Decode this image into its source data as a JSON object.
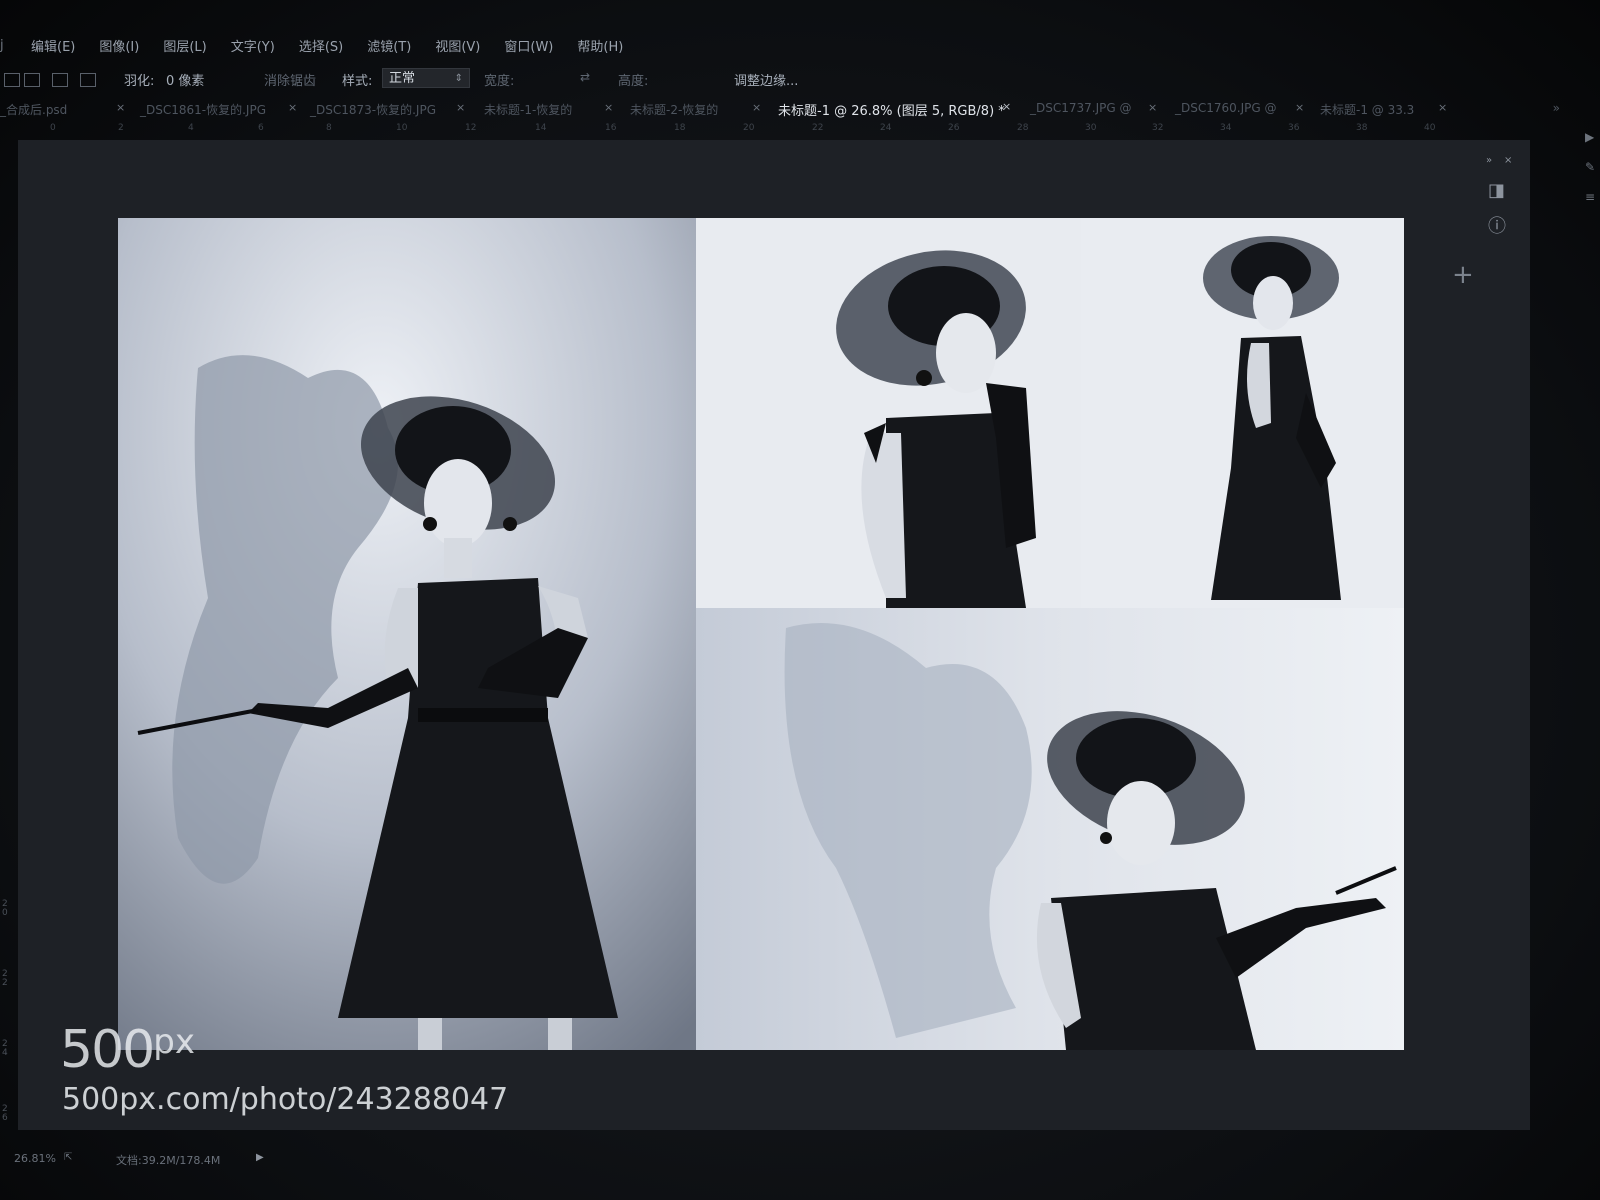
{
  "menubar": {
    "lead": "j",
    "items": [
      "编辑(E)",
      "图像(I)",
      "图层(L)",
      "文字(Y)",
      "选择(S)",
      "滤镜(T)",
      "视图(V)",
      "窗口(W)",
      "帮助(H)"
    ]
  },
  "options": {
    "feather_label": "羽化:",
    "feather_value": "0 像素",
    "antialias_label": "消除锯齿",
    "style_label": "样式:",
    "style_value": "正常",
    "width_label": "宽度:",
    "height_label": "高度:",
    "refine_edge_label": "调整边缘..."
  },
  "tabs": [
    {
      "label": "_合成后.psd"
    },
    {
      "label": "_DSC1861-恢复的.JPG"
    },
    {
      "label": "_DSC1873-恢复的.JPG"
    },
    {
      "label": "未标题-1-恢复的"
    },
    {
      "label": "未标题-2-恢复的"
    },
    {
      "label": "未标题-1 @ 26.8% (图层 5, RGB/8) *",
      "active": true
    },
    {
      "label": "_DSC1737.JPG @"
    },
    {
      "label": "_DSC1760.JPG @"
    },
    {
      "label": "未标题-1 @ 33.3"
    }
  ],
  "tab_scroll": "»",
  "ruler_ticks": [
    "0",
    "2",
    "4",
    "6",
    "8",
    "10",
    "12",
    "14",
    "16",
    "18",
    "20",
    "22",
    "24",
    "26",
    "28",
    "30",
    "32",
    "34",
    "36",
    "38",
    "40"
  ],
  "vruler_ticks": [
    "20",
    "22",
    "24",
    "26"
  ],
  "status": {
    "zoom": "26.81%",
    "doc_size": "文档:39.2M/178.4M",
    "arrow": "▶"
  },
  "right_panel": {
    "collapse": "»",
    "close": "×",
    "crosshair": "+"
  },
  "watermark": {
    "logo_main": "500",
    "logo_px": "px",
    "url": "500px.com/photo/243288047"
  },
  "colors": {
    "canvas_bg": "#b9c0cc",
    "active_tab_text": "#dfe3e9",
    "app_bg": "#1e2126"
  }
}
